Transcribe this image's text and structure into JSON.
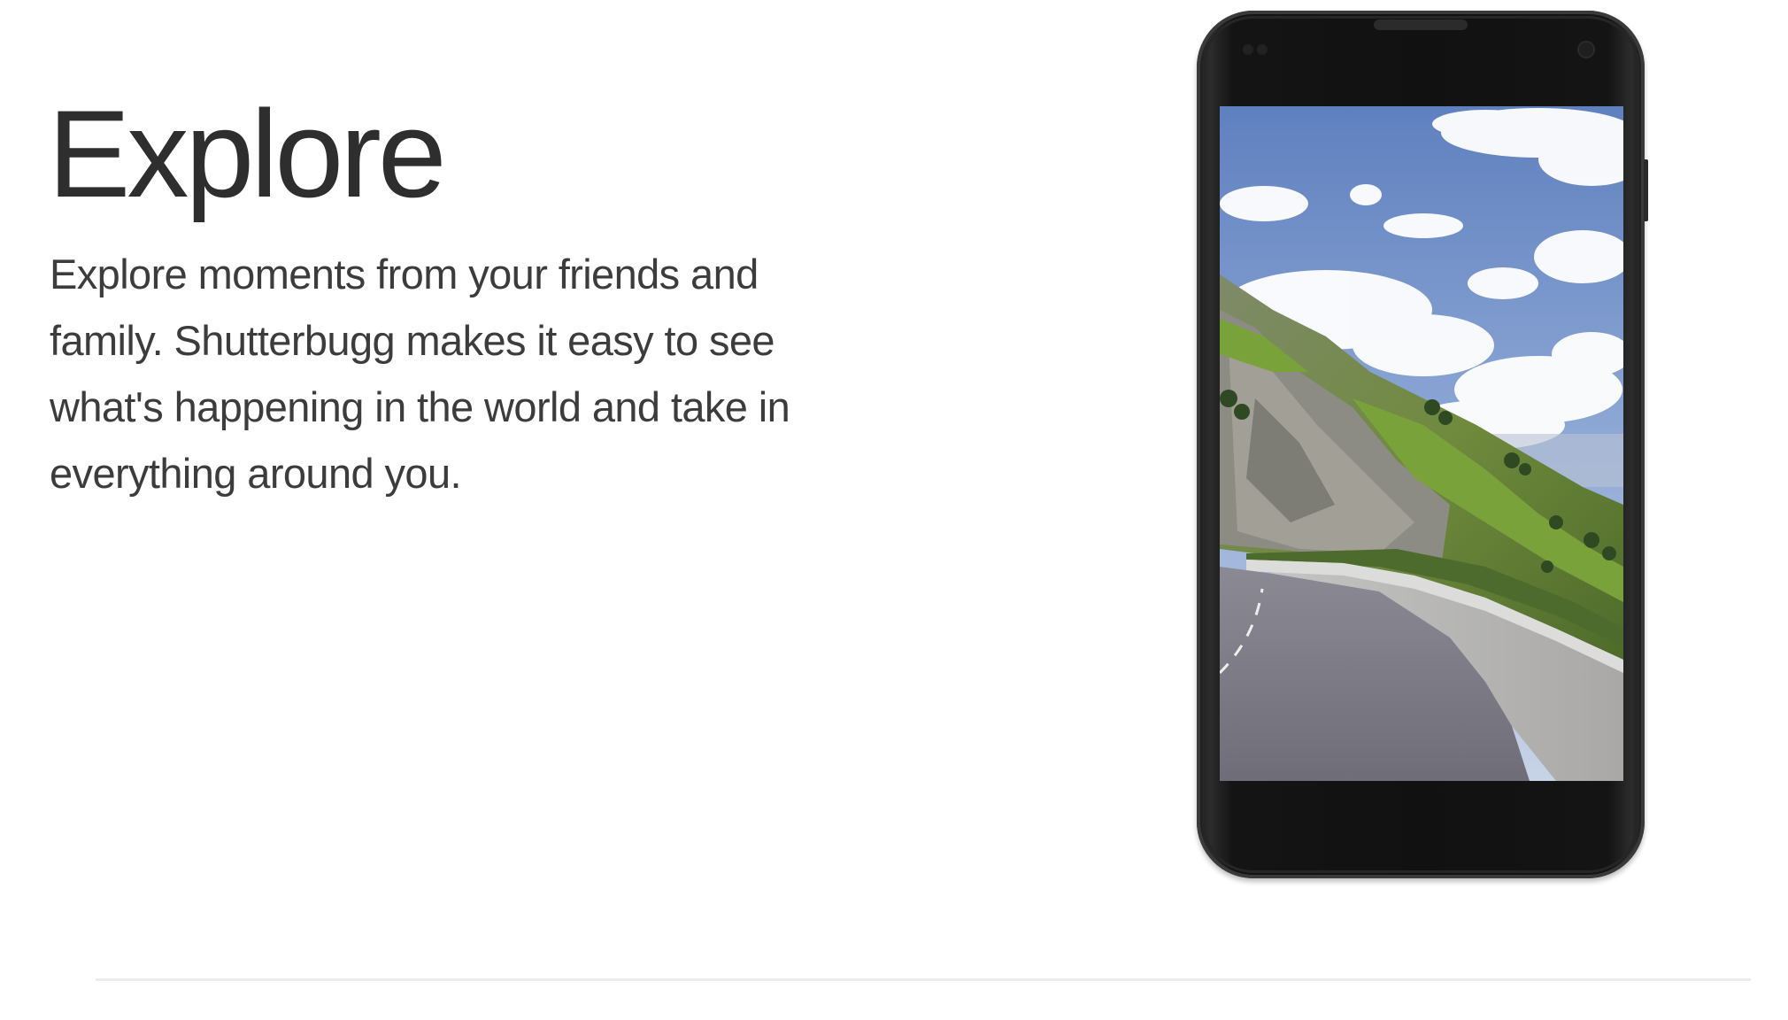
{
  "feature": {
    "heading": "Explore",
    "description": "Explore moments from your friends and family. Shutterbugg makes it easy to see what's happening in the world and take in everything around you."
  },
  "phone": {
    "screen_image": "mountain-road-photo"
  },
  "colors": {
    "text": "#3a3a3a",
    "background": "#ffffff",
    "phone_body": "#111111",
    "divider": "#ebebeb"
  }
}
